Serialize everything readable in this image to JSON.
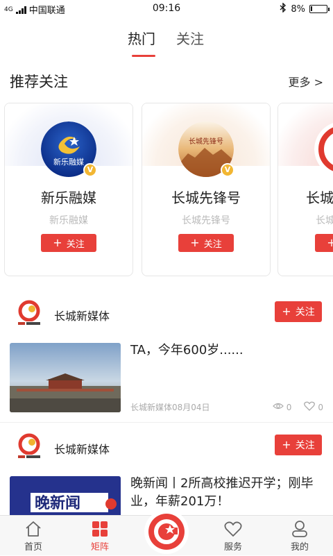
{
  "status_bar": {
    "network": "4G",
    "carrier": "中国联通",
    "time": "09:16",
    "battery_percent": "8%",
    "battery_level": 0.08
  },
  "tabs": [
    {
      "label": "热门",
      "active": true
    },
    {
      "label": "关注",
      "active": false
    }
  ],
  "recommend": {
    "title": "推荐关注",
    "more_label": "更多 >",
    "cards": [
      {
        "name": "新乐融媒",
        "subtitle": "新乐融媒",
        "follow_label": "关注",
        "logo_text": "新乐融媒",
        "verified_badge": "V"
      },
      {
        "name": "长城先锋号",
        "subtitle": "长城先锋号",
        "follow_label": "关注",
        "logo_text": "长城先锋号",
        "verified_badge": "V"
      },
      {
        "name": "长城",
        "subtitle": "长城",
        "follow_label": "关注"
      }
    ]
  },
  "feed": [
    {
      "media_name": "长城新媒体",
      "follow_label": "关注",
      "title": "TA，今年600岁......",
      "meta": "长城新媒体08月04日",
      "views": "0",
      "likes": "0"
    },
    {
      "media_name": "长城新媒体",
      "follow_label": "关注",
      "title": "晚新闻丨2所高校推迟开学；刚毕业，年薪201万！",
      "thumb_text": "晚新闻"
    }
  ],
  "bottom_nav": [
    {
      "label": "首页",
      "icon": "home-icon",
      "active": false
    },
    {
      "label": "矩阵",
      "icon": "grid-icon",
      "active": true
    },
    {
      "label": "服务",
      "icon": "heart-icon",
      "active": false
    },
    {
      "label": "我的",
      "icon": "user-icon",
      "active": false
    }
  ],
  "colors": {
    "accent": "#e8403a",
    "badge": "#f2b632"
  }
}
